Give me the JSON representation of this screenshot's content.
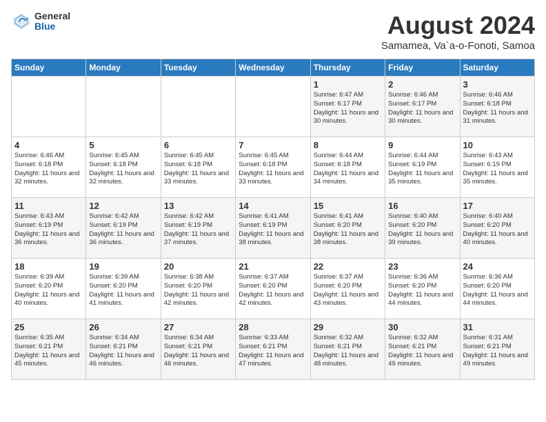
{
  "header": {
    "logo_general": "General",
    "logo_blue": "Blue",
    "title": "August 2024",
    "subtitle": "Samamea, Va`a-o-Fonoti, Samoa"
  },
  "days_of_week": [
    "Sunday",
    "Monday",
    "Tuesday",
    "Wednesday",
    "Thursday",
    "Friday",
    "Saturday"
  ],
  "weeks": [
    [
      {
        "day": "",
        "info": ""
      },
      {
        "day": "",
        "info": ""
      },
      {
        "day": "",
        "info": ""
      },
      {
        "day": "",
        "info": ""
      },
      {
        "day": "1",
        "info": "Sunrise: 6:47 AM\nSunset: 6:17 PM\nDaylight: 11 hours\nand 30 minutes."
      },
      {
        "day": "2",
        "info": "Sunrise: 6:46 AM\nSunset: 6:17 PM\nDaylight: 11 hours\nand 30 minutes."
      },
      {
        "day": "3",
        "info": "Sunrise: 6:46 AM\nSunset: 6:18 PM\nDaylight: 11 hours\nand 31 minutes."
      }
    ],
    [
      {
        "day": "4",
        "info": "Sunrise: 6:46 AM\nSunset: 6:18 PM\nDaylight: 11 hours\nand 32 minutes."
      },
      {
        "day": "5",
        "info": "Sunrise: 6:45 AM\nSunset: 6:18 PM\nDaylight: 11 hours\nand 32 minutes."
      },
      {
        "day": "6",
        "info": "Sunrise: 6:45 AM\nSunset: 6:18 PM\nDaylight: 11 hours\nand 33 minutes."
      },
      {
        "day": "7",
        "info": "Sunrise: 6:45 AM\nSunset: 6:18 PM\nDaylight: 11 hours\nand 33 minutes."
      },
      {
        "day": "8",
        "info": "Sunrise: 6:44 AM\nSunset: 6:18 PM\nDaylight: 11 hours\nand 34 minutes."
      },
      {
        "day": "9",
        "info": "Sunrise: 6:44 AM\nSunset: 6:19 PM\nDaylight: 11 hours\nand 35 minutes."
      },
      {
        "day": "10",
        "info": "Sunrise: 6:43 AM\nSunset: 6:19 PM\nDaylight: 11 hours\nand 35 minutes."
      }
    ],
    [
      {
        "day": "11",
        "info": "Sunrise: 6:43 AM\nSunset: 6:19 PM\nDaylight: 11 hours\nand 36 minutes."
      },
      {
        "day": "12",
        "info": "Sunrise: 6:42 AM\nSunset: 6:19 PM\nDaylight: 11 hours\nand 36 minutes."
      },
      {
        "day": "13",
        "info": "Sunrise: 6:42 AM\nSunset: 6:19 PM\nDaylight: 11 hours\nand 37 minutes."
      },
      {
        "day": "14",
        "info": "Sunrise: 6:41 AM\nSunset: 6:19 PM\nDaylight: 11 hours\nand 38 minutes."
      },
      {
        "day": "15",
        "info": "Sunrise: 6:41 AM\nSunset: 6:20 PM\nDaylight: 11 hours\nand 38 minutes."
      },
      {
        "day": "16",
        "info": "Sunrise: 6:40 AM\nSunset: 6:20 PM\nDaylight: 11 hours\nand 39 minutes."
      },
      {
        "day": "17",
        "info": "Sunrise: 6:40 AM\nSunset: 6:20 PM\nDaylight: 11 hours\nand 40 minutes."
      }
    ],
    [
      {
        "day": "18",
        "info": "Sunrise: 6:39 AM\nSunset: 6:20 PM\nDaylight: 11 hours\nand 40 minutes."
      },
      {
        "day": "19",
        "info": "Sunrise: 6:39 AM\nSunset: 6:20 PM\nDaylight: 11 hours\nand 41 minutes."
      },
      {
        "day": "20",
        "info": "Sunrise: 6:38 AM\nSunset: 6:20 PM\nDaylight: 11 hours\nand 42 minutes."
      },
      {
        "day": "21",
        "info": "Sunrise: 6:37 AM\nSunset: 6:20 PM\nDaylight: 11 hours\nand 42 minutes."
      },
      {
        "day": "22",
        "info": "Sunrise: 6:37 AM\nSunset: 6:20 PM\nDaylight: 11 hours\nand 43 minutes."
      },
      {
        "day": "23",
        "info": "Sunrise: 6:36 AM\nSunset: 6:20 PM\nDaylight: 11 hours\nand 44 minutes."
      },
      {
        "day": "24",
        "info": "Sunrise: 6:36 AM\nSunset: 6:20 PM\nDaylight: 11 hours\nand 44 minutes."
      }
    ],
    [
      {
        "day": "25",
        "info": "Sunrise: 6:35 AM\nSunset: 6:21 PM\nDaylight: 11 hours\nand 45 minutes."
      },
      {
        "day": "26",
        "info": "Sunrise: 6:34 AM\nSunset: 6:21 PM\nDaylight: 11 hours\nand 46 minutes."
      },
      {
        "day": "27",
        "info": "Sunrise: 6:34 AM\nSunset: 6:21 PM\nDaylight: 11 hours\nand 46 minutes."
      },
      {
        "day": "28",
        "info": "Sunrise: 6:33 AM\nSunset: 6:21 PM\nDaylight: 11 hours\nand 47 minutes."
      },
      {
        "day": "29",
        "info": "Sunrise: 6:32 AM\nSunset: 6:21 PM\nDaylight: 11 hours\nand 48 minutes."
      },
      {
        "day": "30",
        "info": "Sunrise: 6:32 AM\nSunset: 6:21 PM\nDaylight: 11 hours\nand 49 minutes."
      },
      {
        "day": "31",
        "info": "Sunrise: 6:31 AM\nSunset: 6:21 PM\nDaylight: 11 hours\nand 49 minutes."
      }
    ]
  ]
}
